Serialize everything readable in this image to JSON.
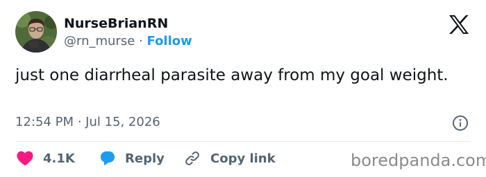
{
  "tweet": {
    "author": {
      "display_name": "NurseBrianRN",
      "handle": "@rn_murse",
      "separator": "·",
      "follow_label": "Follow"
    },
    "text": "just one diarrheal parasite away from my goal weight.",
    "timestamp": "12:54 PM · Jul 15, 2026"
  },
  "actions": {
    "likes_count": "4.1K",
    "reply_label": "Reply",
    "copy_link_label": "Copy link"
  },
  "watermark": "boredpanda.com",
  "icons": {
    "logo": "x-logo-icon",
    "info": "info-icon",
    "like": "heart-icon",
    "reply": "speech-bubble-icon",
    "copy": "link-icon"
  },
  "colors": {
    "like": "#f91880",
    "reply": "#1d9bf0",
    "follow": "#1d9bf0",
    "secondary_text": "#536471",
    "watermark": "#8a8a8a"
  }
}
